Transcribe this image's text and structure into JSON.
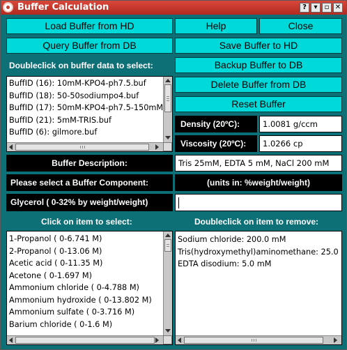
{
  "window": {
    "title": "Buffer Calculation",
    "controls": {
      "help": "?",
      "minimize": "▾",
      "maximize": "▫",
      "close": "✕"
    }
  },
  "buttons": {
    "load_hd": "Load Buffer from HD",
    "help": "Help",
    "close": "Close",
    "query_db": "Query Buffer from DB",
    "save_hd": "Save Buffer to HD",
    "backup_db": "Backup Buffer to DB",
    "delete_db": "Delete Buffer from DB",
    "reset": "Reset Buffer"
  },
  "buffer_list": {
    "heading": "Doubleclick on buffer data to select:",
    "items": [
      "BuffID (16): 10mM-KPO4-ph7.5.buf",
      "BuffID (18): 50-50sodiumpo4.buf",
      "BuffID (17): 50mM-KPO4-ph7.5-150mM",
      "BuffID (21): 5mM-TRIS.buf",
      "BuffID (6): gilmore.buf"
    ]
  },
  "density": {
    "label": "Density (20ºC):",
    "value": "1.0081 g/ccm"
  },
  "viscosity": {
    "label": "Viscosity (20ºC):",
    "value": "1.0266 cp"
  },
  "description": {
    "label": "Buffer Description:",
    "value": "Tris 25mM, EDTA 5 mM, NaCl 200 mM"
  },
  "component": {
    "prompt": "Please select a Buffer Component:",
    "units": "(units in: %weight/weight)",
    "selected": "Glycerol ( 0-32% by weight/weight)",
    "input_value": ""
  },
  "select_list": {
    "heading": "Click on item to select:",
    "items": [
      "1-Propanol ( 0-6.741 M)",
      "2-Propanol ( 0-13.06 M)",
      "Acetic acid ( 0-11.35 M)",
      "Acetone ( 0-1.697 M)",
      "Ammonium chloride ( 0-4.788 M)",
      "Ammonium hydroxide ( 0-13.802 M)",
      "Ammonium sulfate ( 0-3.716 M)",
      "Barium chloride ( 0-1.6 M)"
    ]
  },
  "remove_list": {
    "heading": "Doubleclick on item to remove:",
    "items": [
      "Sodium chloride: 200.0 mM",
      "Tris(hydroxymethyl)aminomethane:  25.0 m",
      "EDTA disodium:   5.0 mM"
    ]
  },
  "colors": {
    "background": "#0d7077",
    "button": "#00d9d9",
    "titlebar": "#c8392e"
  }
}
